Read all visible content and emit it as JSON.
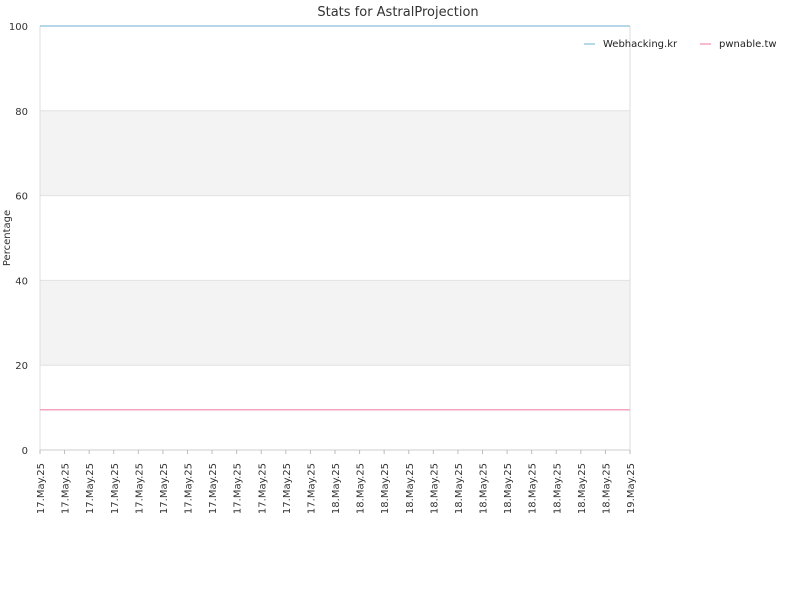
{
  "chart_data": {
    "type": "line",
    "title": "Stats for AstralProjection",
    "xlabel": "",
    "ylabel": "Percentage",
    "ylim": [
      0,
      100
    ],
    "yticks": [
      0,
      20,
      40,
      60,
      80,
      100
    ],
    "grid": true,
    "alternating_bands": true,
    "legend_position": "top-right",
    "categories": [
      "17.May.25",
      "17.May.25",
      "17.May.25",
      "17.May.25",
      "17.May.25",
      "17.May.25",
      "17.May.25",
      "17.May.25",
      "17.May.25",
      "17.May.25",
      "17.May.25",
      "17.May.25",
      "18.May.25",
      "18.May.25",
      "18.May.25",
      "18.May.25",
      "18.May.25",
      "18.May.25",
      "18.May.25",
      "18.May.25",
      "18.May.25",
      "18.May.25",
      "18.May.25",
      "18.May.25",
      "19.May.25"
    ],
    "series": [
      {
        "name": "Webhacking.kr",
        "color": "#9ecae1",
        "values": [
          100,
          100,
          100,
          100,
          100,
          100,
          100,
          100,
          100,
          100,
          100,
          100,
          100,
          100,
          100,
          100,
          100,
          100,
          100,
          100,
          100,
          100,
          100,
          100,
          100
        ]
      },
      {
        "name": "pwnable.tw",
        "color": "#f4a3c0",
        "values": [
          9.5,
          9.5,
          9.5,
          9.5,
          9.5,
          9.5,
          9.5,
          9.5,
          9.5,
          9.5,
          9.5,
          9.5,
          9.5,
          9.5,
          9.5,
          9.5,
          9.5,
          9.5,
          9.5,
          9.5,
          9.5,
          9.5,
          9.5,
          9.5,
          9.5
        ]
      }
    ]
  }
}
